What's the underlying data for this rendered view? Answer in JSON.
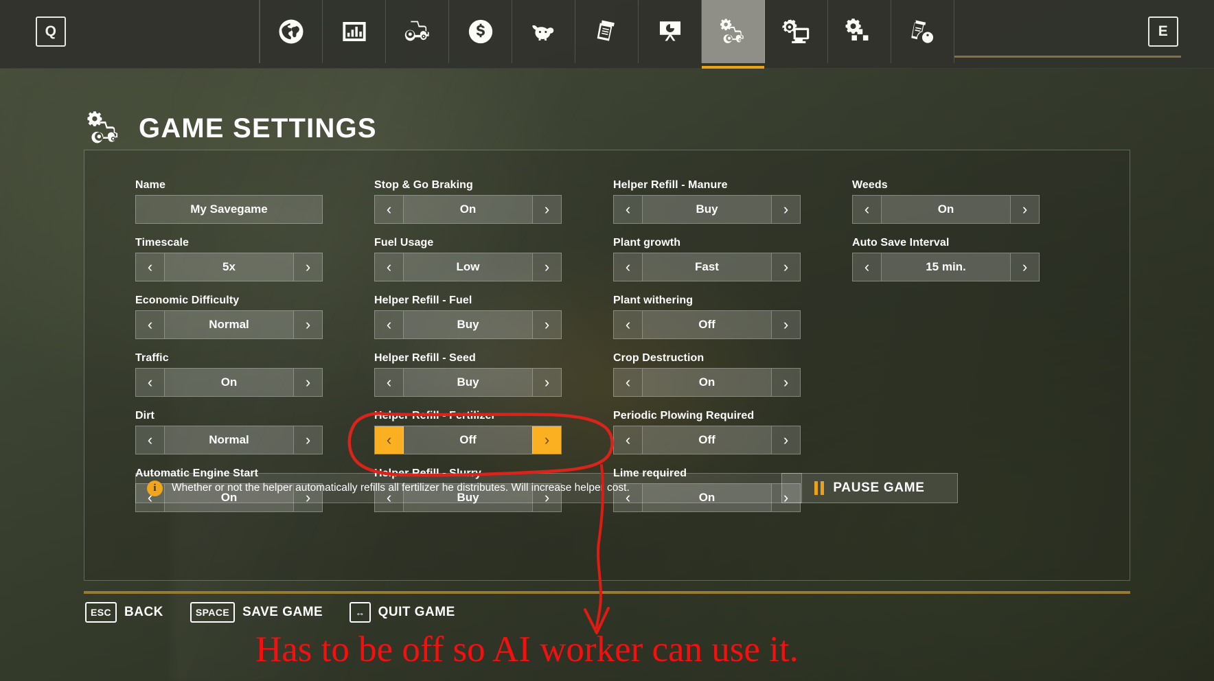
{
  "topbar": {
    "left_key": "Q",
    "right_key": "E",
    "tabs": [
      {
        "icon": "globe-icon",
        "name": "map",
        "active": false
      },
      {
        "icon": "bar-chart-icon",
        "name": "statistics",
        "active": false
      },
      {
        "icon": "tractor-icon",
        "name": "vehicles",
        "active": false
      },
      {
        "icon": "dollar-coin-icon",
        "name": "finances",
        "active": false
      },
      {
        "icon": "cow-icon",
        "name": "animals",
        "active": false
      },
      {
        "icon": "documents-icon",
        "name": "contracts",
        "active": false
      },
      {
        "icon": "easel-chart-icon",
        "name": "prices",
        "active": false
      },
      {
        "icon": "gear-tractor-icon",
        "name": "game-settings",
        "active": true
      },
      {
        "icon": "gear-monitor-icon",
        "name": "general-settings",
        "active": false
      },
      {
        "icon": "gear-blocks-icon",
        "name": "mods-settings",
        "active": false
      },
      {
        "icon": "documents-info-icon",
        "name": "help",
        "active": false
      }
    ]
  },
  "header": {
    "title": "GAME SETTINGS",
    "icon": "gear-tractor-icon"
  },
  "columns": [
    {
      "settings": [
        {
          "label": "Name",
          "value": "My Savegame",
          "type": "text",
          "highlight": false
        },
        {
          "label": "Timescale",
          "value": "5x",
          "type": "stepper",
          "highlight": false
        },
        {
          "label": "Economic Difficulty",
          "value": "Normal",
          "type": "stepper",
          "highlight": false
        },
        {
          "label": "Traffic",
          "value": "On",
          "type": "stepper",
          "highlight": false
        },
        {
          "label": "Dirt",
          "value": "Normal",
          "type": "stepper",
          "highlight": false
        },
        {
          "label": "Automatic Engine Start",
          "value": "On",
          "type": "stepper",
          "highlight": false
        }
      ]
    },
    {
      "settings": [
        {
          "label": "Stop & Go Braking",
          "value": "On",
          "type": "stepper",
          "highlight": false
        },
        {
          "label": "Fuel Usage",
          "value": "Low",
          "type": "stepper",
          "highlight": false
        },
        {
          "label": "Helper Refill - Fuel",
          "value": "Buy",
          "type": "stepper",
          "highlight": false
        },
        {
          "label": "Helper Refill - Seed",
          "value": "Buy",
          "type": "stepper",
          "highlight": false
        },
        {
          "label": "Helper Refill - Fertilizer",
          "value": "Off",
          "type": "stepper",
          "highlight": true
        },
        {
          "label": "Helper Refill - Slurry",
          "value": "Buy",
          "type": "stepper",
          "highlight": false
        }
      ]
    },
    {
      "settings": [
        {
          "label": "Helper Refill - Manure",
          "value": "Buy",
          "type": "stepper",
          "highlight": false
        },
        {
          "label": "Plant growth",
          "value": "Fast",
          "type": "stepper",
          "highlight": false
        },
        {
          "label": "Plant withering",
          "value": "Off",
          "type": "stepper",
          "highlight": false
        },
        {
          "label": "Crop Destruction",
          "value": "On",
          "type": "stepper",
          "highlight": false
        },
        {
          "label": "Periodic Plowing Required",
          "value": "Off",
          "type": "stepper",
          "highlight": false
        },
        {
          "label": "Lime required",
          "value": "On",
          "type": "stepper",
          "highlight": false
        }
      ]
    },
    {
      "settings": [
        {
          "label": "Weeds",
          "value": "On",
          "type": "stepper",
          "highlight": false
        },
        {
          "label": "Auto Save Interval",
          "value": "15 min.",
          "type": "stepper",
          "highlight": false
        }
      ]
    }
  ],
  "info": {
    "icon": "info-icon",
    "text": "Whether or not the helper automatically refills all fertilizer he distributes. Will increase helper cost."
  },
  "pause": {
    "icon": "pause-icon",
    "label": "PAUSE GAME"
  },
  "footer": [
    {
      "key": "ESC",
      "label": "BACK"
    },
    {
      "key": "SPACE",
      "label": "SAVE GAME"
    },
    {
      "key": "↔",
      "label": "QUIT GAME"
    }
  ],
  "annotation": {
    "text": "Has to be off so AI worker can use it.",
    "color": "#f60f0f",
    "target_setting": "Helper Refill - Fertilizer"
  },
  "colors": {
    "accent_orange": "#fbb022",
    "underline_gold": "#e8a21c",
    "panel_border": "rgba(255,255,255,0.26)",
    "annotation_red": "#f60f0f"
  },
  "arrows": {
    "left": "‹",
    "right": "›"
  }
}
